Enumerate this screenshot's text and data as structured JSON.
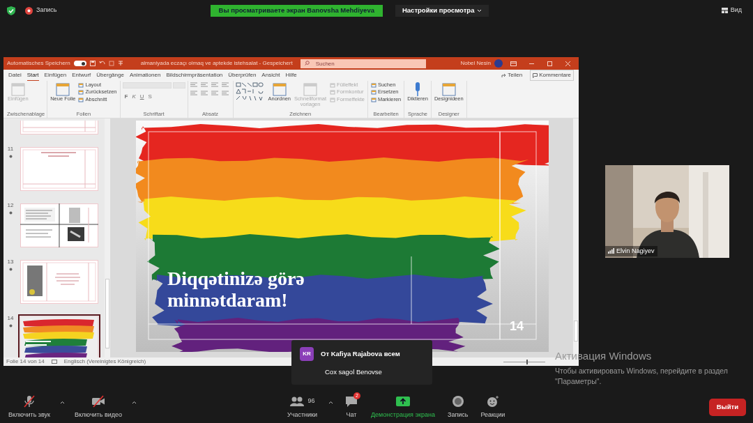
{
  "top_bar": {
    "recording_label": "Запись",
    "share_banner": "Вы просматриваете экран Banovsha Mehdiyeva",
    "view_options": "Настройки просмотра",
    "view_button": "Вид"
  },
  "presentation_window": {
    "autosave_label": "Automatisches Speichern",
    "autosave_on": true,
    "document_title": "almaniyada eczaçı olmaq ve aptekde istehsalat - Gespeichert",
    "search_placeholder": "Suchen",
    "user_name": "Nobel Nesin",
    "tabs": [
      {
        "label": "Datei",
        "selected": false
      },
      {
        "label": "Start",
        "selected": true
      },
      {
        "label": "Einfügen",
        "selected": false
      },
      {
        "label": "Entwurf",
        "selected": false
      },
      {
        "label": "Übergänge",
        "selected": false
      },
      {
        "label": "Animationen",
        "selected": false
      },
      {
        "label": "Bildschirmpräsentation",
        "selected": false
      },
      {
        "label": "Überprüfen",
        "selected": false
      },
      {
        "label": "Ansicht",
        "selected": false
      },
      {
        "label": "Hilfe",
        "selected": false
      }
    ],
    "share_button": "Teilen",
    "comments_button": "Kommentare",
    "ribbon_groups": [
      {
        "name": "Zwischenablage",
        "kind": "buttons",
        "buttons": [
          {
            "label": "Einfügen",
            "kind": "large",
            "disabled": true
          }
        ]
      },
      {
        "name": "Folien",
        "kind": "buttons",
        "buttons": [
          {
            "label": "Neue Folie",
            "kind": "large",
            "disabled": false
          },
          {
            "label": "Layout",
            "kind": "small",
            "disabled": false
          },
          {
            "label": "Zurücksetzen",
            "kind": "small",
            "disabled": false
          },
          {
            "label": "Abschnitt",
            "kind": "small",
            "disabled": false
          }
        ]
      },
      {
        "name": "Schriftart",
        "kind": "font",
        "format_buttons": [
          "F",
          "K",
          "U",
          "S"
        ]
      },
      {
        "name": "Absatz",
        "kind": "paragraph"
      },
      {
        "name": "Zeichnen",
        "kind": "shapes",
        "buttons": [
          {
            "label": "Anordnen",
            "kind": "large",
            "disabled": false
          },
          {
            "label": "Schnellformatvorlagen",
            "kind": "large",
            "disabled": true
          },
          {
            "label": "Fülleffekt",
            "kind": "small",
            "disabled": true
          },
          {
            "label": "Formkontur",
            "kind": "small",
            "disabled": true
          },
          {
            "label": "Formeffekte",
            "kind": "small",
            "disabled": true
          }
        ]
      },
      {
        "name": "Bearbeiten",
        "kind": "buttons",
        "buttons": [
          {
            "label": "Suchen",
            "kind": "small",
            "disabled": false
          },
          {
            "label": "Ersetzen",
            "kind": "small",
            "disabled": false
          },
          {
            "label": "Markieren",
            "kind": "small",
            "disabled": false
          }
        ]
      },
      {
        "name": "Sprache",
        "kind": "buttons",
        "buttons": [
          {
            "label": "Diktieren",
            "kind": "mic",
            "disabled": false
          }
        ]
      },
      {
        "name": "Designer",
        "kind": "buttons",
        "buttons": [
          {
            "label": "Designideen",
            "kind": "large",
            "disabled": false
          }
        ]
      }
    ],
    "thumbnails": [
      {
        "kind": "title",
        "cropped": true,
        "selected": false
      },
      {
        "number": "11",
        "kind": "title",
        "cropped": false,
        "selected": false
      },
      {
        "number": "12",
        "kind": "images",
        "cropped": false,
        "selected": false
      },
      {
        "number": "13",
        "cropped": false,
        "selected": false
      },
      {
        "number": "14",
        "kind": "rainbow",
        "cropped": false,
        "selected": true
      }
    ],
    "slide": {
      "title": "Diqqətinizə görə minnətdaram!",
      "number": "14"
    },
    "status_bar": {
      "slide_position": "Folie 14 von 14",
      "language": "Englisch (Vereinigtes Königreich)",
      "zoom_slider": {
        "level": 0.55
      }
    }
  },
  "video_tile": {
    "name": "Elvin Nagiyev"
  },
  "chat_notification": {
    "initials": "KR",
    "sender": "От Kafiya Rajabova всем",
    "message": "Cox sagol Benovse"
  },
  "windows_activation": {
    "title": "Активация Windows",
    "message": "Чтобы активировать Windows, перейдите в раздел \"Параметры\"."
  },
  "toolbar": {
    "items": [
      {
        "kind": "microphone",
        "label": "Включить звук",
        "off": true,
        "caret": true
      },
      {
        "kind": "camera",
        "label": "Включить видео",
        "off": true,
        "caret": true
      },
      {
        "kind": "participants",
        "label": "Участники",
        "count": "96",
        "off": false,
        "caret": true
      },
      {
        "kind": "chat",
        "label": "Чат",
        "badge": "2",
        "off": false,
        "caret": false
      },
      {
        "kind": "share",
        "label": "Демонстрация экрана",
        "off": false,
        "caret": false
      },
      {
        "kind": "record",
        "label": "Запись",
        "off": false,
        "caret": false
      },
      {
        "kind": "reactions",
        "label": "Реакции",
        "off": false,
        "caret": false
      }
    ],
    "leave_button": "Выйти"
  }
}
